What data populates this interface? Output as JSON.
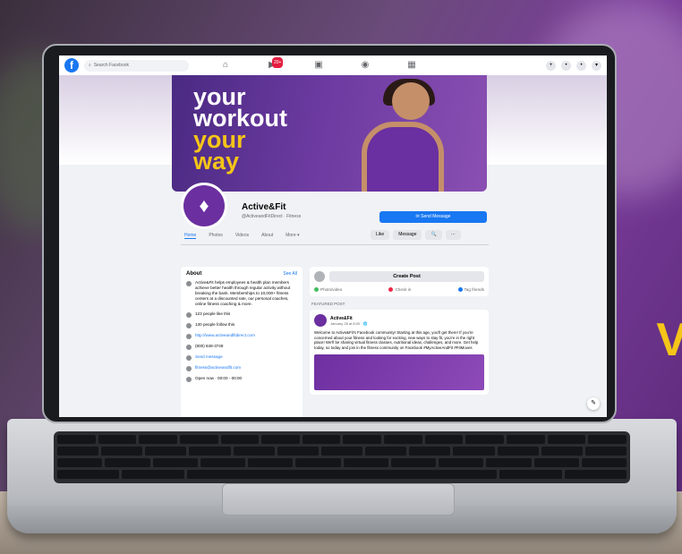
{
  "scene": {
    "edge_text": "V"
  },
  "topbar": {
    "search_placeholder": "Search Facebook",
    "notification_count": "20+"
  },
  "cover": {
    "lines": [
      "your",
      "workout",
      "your",
      "way"
    ],
    "line_colors": [
      "#ffffff",
      "#ffffff",
      "#f5c518",
      "#f5c518"
    ]
  },
  "page": {
    "name": "Active&Fit",
    "handle": "@ActiveandFitDirect · Fitness",
    "send_message_label": "Send Message",
    "tabs": [
      "Home",
      "Photos",
      "Videos",
      "About",
      "More ▾"
    ],
    "actions": {
      "like": "Like",
      "message": "Message",
      "search": "🔍",
      "more": "···"
    }
  },
  "about": {
    "title": "About",
    "see_all": "See All",
    "description": "Active&Fit helps employees & health plan members achieve better health through regular activity without breaking the bank. Memberships to 10,000+ fitness centers at a discounted rate, our personal coaches, online fitness coaching & more.",
    "rows": [
      {
        "text": "123 people like this",
        "link": false
      },
      {
        "text": "130 people follow this",
        "link": false
      },
      {
        "text": "http://www.activeandfitdirect.com",
        "link": true
      },
      {
        "text": "(800) 848-3748",
        "link": false
      },
      {
        "text": "Send message",
        "link": true
      },
      {
        "text": "fitness@activeandfit.com",
        "link": true
      },
      {
        "text": "Open now · 00:00 - 00:00",
        "link": false
      }
    ]
  },
  "feed": {
    "create_post": "Create Post",
    "actions": [
      "Photo/video",
      "Check in",
      "Tag friends"
    ],
    "featured_label": "FEATURED POST",
    "post": {
      "author": "Active&Fit",
      "time": "January 28 at 8:00 · 🌐",
      "text": "Welcome to Active&Fit's Facebook community! Starting at this age, you'll get there! If you're concerned about your fitness and looking for exciting, new ways to stay fit, you're in the right place! We'll be sharing virtual fitness classes, nutritional ideas, challenges, and more. Get help today, so today and join in the fitness community on Facebook #MyActiveAndFit #FitMoves"
    }
  },
  "colors": {
    "fb_blue": "#1877f2",
    "brand_purple": "#6b2fa0",
    "accent_yellow": "#f5c518"
  }
}
